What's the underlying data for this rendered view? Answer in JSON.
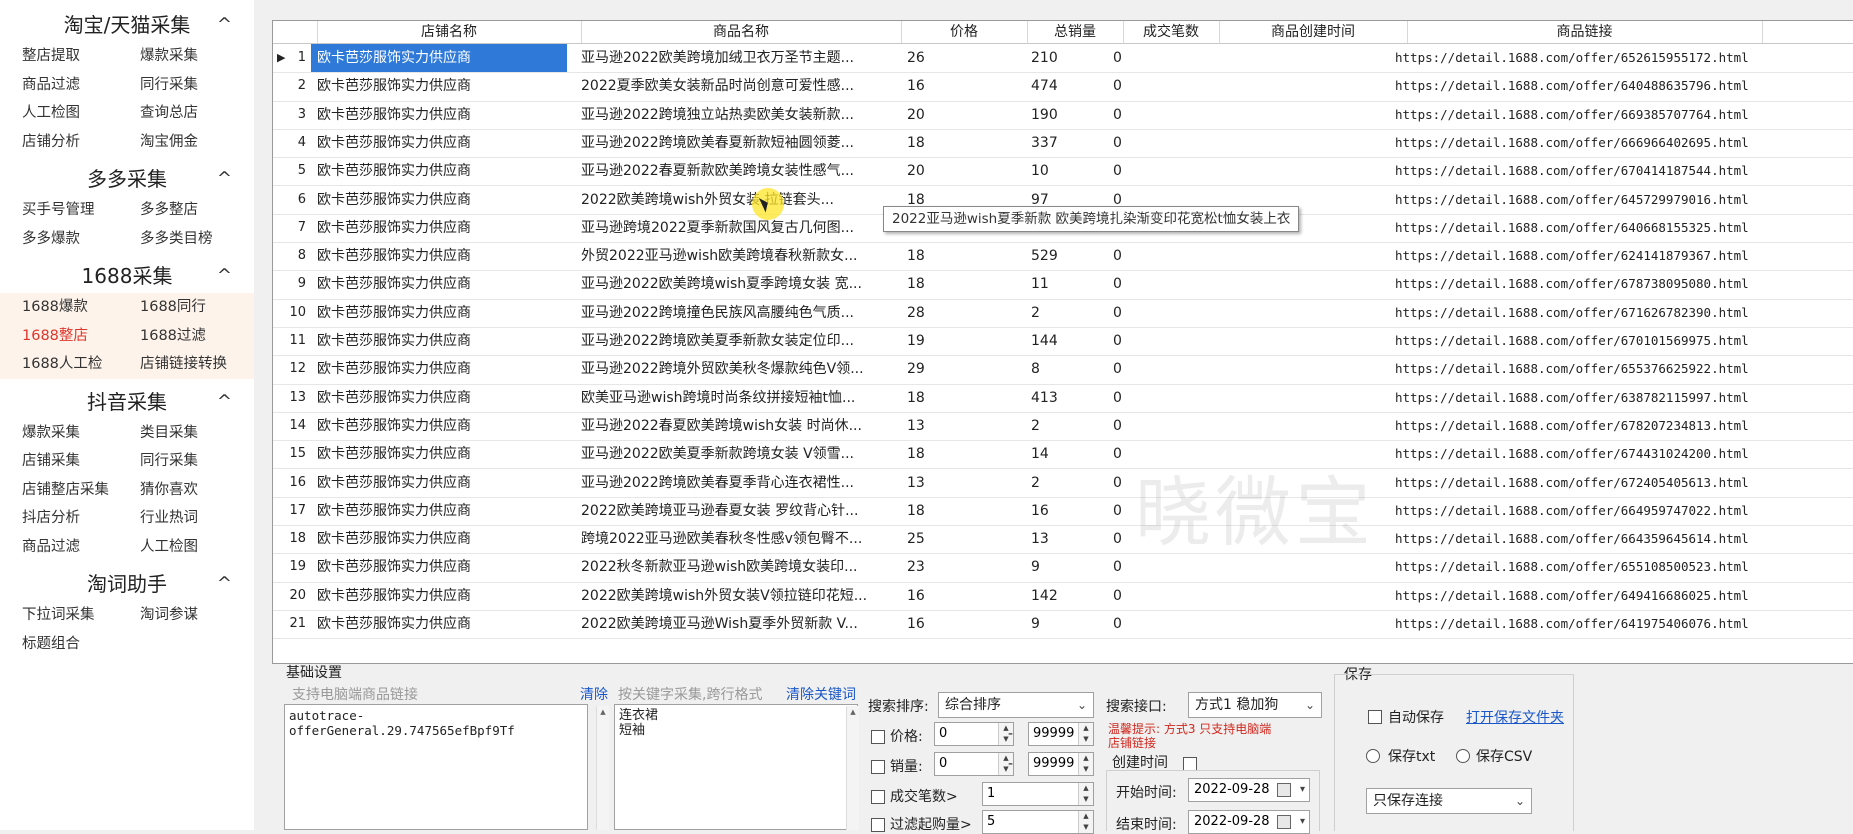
{
  "sidebar": {
    "sections": [
      {
        "title": "淘宝/天猫采集",
        "items": [
          "整店提取",
          "爆款采集",
          "商品过滤",
          "同行采集",
          "人工检图",
          "查询总店",
          "店铺分析",
          "淘宝佣金"
        ]
      },
      {
        "title": "多多采集",
        "items": [
          "买手号管理",
          "多多整店",
          "多多爆款",
          "多多类目榜"
        ]
      },
      {
        "title": "1688采集",
        "items": [
          "1688爆款",
          "1688同行",
          "1688整店",
          "1688过滤",
          "1688人工检",
          "店铺链接转换"
        ]
      },
      {
        "title": "抖音采集",
        "items": [
          "爆款采集",
          "类目采集",
          "店铺采集",
          "同行采集",
          "店铺整店采集",
          "猜你喜欢",
          "抖店分析",
          "行业热词",
          "商品过滤",
          "人工检图"
        ]
      },
      {
        "title": "淘词助手",
        "items": [
          "下拉词采集",
          "淘词参谋",
          "标题组合"
        ]
      }
    ],
    "chevron": "^"
  },
  "table": {
    "headers": [
      "店铺名称",
      "商品名称",
      "价格",
      "总销量",
      "成交笔数",
      "商品创建时间",
      "商品链接"
    ],
    "rows": [
      {
        "idx": "1",
        "shop": "欧卡芭莎服饰实力供应商",
        "name": "亚马逊2022欧美跨境加绒卫衣万圣节主题...",
        "price": "26",
        "sales": "210",
        "deals": "0",
        "link": "https://detail.1688.com/offer/652615955172.html"
      },
      {
        "idx": "2",
        "shop": "欧卡芭莎服饰实力供应商",
        "name": "2022夏季欧美女装新品时尚创意可爱性感...",
        "price": "16",
        "sales": "474",
        "deals": "0",
        "link": "https://detail.1688.com/offer/640488635796.html"
      },
      {
        "idx": "3",
        "shop": "欧卡芭莎服饰实力供应商",
        "name": "亚马逊2022跨境独立站热卖欧美女装新款...",
        "price": "20",
        "sales": "190",
        "deals": "0",
        "link": "https://detail.1688.com/offer/669385707764.html"
      },
      {
        "idx": "4",
        "shop": "欧卡芭莎服饰实力供应商",
        "name": "亚马逊2022跨境欧美春夏新款短袖圆领菱...",
        "price": "18",
        "sales": "337",
        "deals": "0",
        "link": "https://detail.1688.com/offer/666966402695.html"
      },
      {
        "idx": "5",
        "shop": "欧卡芭莎服饰实力供应商",
        "name": "亚马逊2022春夏新款欧美跨境女装性感气...",
        "price": "20",
        "sales": "10",
        "deals": "0",
        "link": "https://detail.1688.com/offer/670414187544.html"
      },
      {
        "idx": "6",
        "shop": "欧卡芭莎服饰实力供应商",
        "name": "2022欧美跨境wish外贸女装 拉链套头...",
        "price": "18",
        "sales": "97",
        "deals": "0",
        "link": "https://detail.1688.com/offer/645729979016.html"
      },
      {
        "idx": "7",
        "shop": "欧卡芭莎服饰实力供应商",
        "name": "亚马逊跨境2022夏季新款国风复古几何图...",
        "price": "18",
        "sales": "148",
        "deals": "0",
        "link": "https://detail.1688.com/offer/640668155325.html"
      },
      {
        "idx": "8",
        "shop": "欧卡芭莎服饰实力供应商",
        "name": "外贸2022亚马逊wish欧美跨境春秋新款女...",
        "price": "18",
        "sales": "529",
        "deals": "0",
        "link": "https://detail.1688.com/offer/624141879367.html"
      },
      {
        "idx": "9",
        "shop": "欧卡芭莎服饰实力供应商",
        "name": "亚马逊2022欧美跨境wish夏季跨境女装 宽...",
        "price": "18",
        "sales": "11",
        "deals": "0",
        "link": "https://detail.1688.com/offer/678738095080.html"
      },
      {
        "idx": "10",
        "shop": "欧卡芭莎服饰实力供应商",
        "name": "亚马逊2022跨境撞色民族风高腰纯色气质...",
        "price": "28",
        "sales": "2",
        "deals": "0",
        "link": "https://detail.1688.com/offer/671626782390.html"
      },
      {
        "idx": "11",
        "shop": "欧卡芭莎服饰实力供应商",
        "name": "亚马逊2022跨境欧美夏季新款女装定位印...",
        "price": "19",
        "sales": "144",
        "deals": "0",
        "link": "https://detail.1688.com/offer/670101569975.html"
      },
      {
        "idx": "12",
        "shop": "欧卡芭莎服饰实力供应商",
        "name": "亚马逊2022跨境外贸欧美秋冬爆款纯色V领...",
        "price": "29",
        "sales": "8",
        "deals": "0",
        "link": "https://detail.1688.com/offer/655376625922.html"
      },
      {
        "idx": "13",
        "shop": "欧卡芭莎服饰实力供应商",
        "name": "欧美亚马逊wish跨境时尚条纹拼接短袖t恤...",
        "price": "18",
        "sales": "413",
        "deals": "0",
        "link": "https://detail.1688.com/offer/638782115997.html"
      },
      {
        "idx": "14",
        "shop": "欧卡芭莎服饰实力供应商",
        "name": "亚马逊2022春夏欧美跨境wish女装 时尚休...",
        "price": "13",
        "sales": "2",
        "deals": "0",
        "link": "https://detail.1688.com/offer/678207234813.html"
      },
      {
        "idx": "15",
        "shop": "欧卡芭莎服饰实力供应商",
        "name": "亚马逊2022欧美夏季新款跨境女装 V领雪...",
        "price": "18",
        "sales": "14",
        "deals": "0",
        "link": "https://detail.1688.com/offer/674431024200.html"
      },
      {
        "idx": "16",
        "shop": "欧卡芭莎服饰实力供应商",
        "name": "亚马逊2022跨境欧美春夏季背心连衣裙性...",
        "price": "13",
        "sales": "2",
        "deals": "0",
        "link": "https://detail.1688.com/offer/672405405613.html"
      },
      {
        "idx": "17",
        "shop": "欧卡芭莎服饰实力供应商",
        "name": "2022欧美跨境亚马逊春夏女装 罗纹背心针...",
        "price": "18",
        "sales": "16",
        "deals": "0",
        "link": "https://detail.1688.com/offer/664959747022.html"
      },
      {
        "idx": "18",
        "shop": "欧卡芭莎服饰实力供应商",
        "name": "跨境2022亚马逊欧美春秋冬性感v领包臀不...",
        "price": "25",
        "sales": "13",
        "deals": "0",
        "link": "https://detail.1688.com/offer/664359645614.html"
      },
      {
        "idx": "19",
        "shop": "欧卡芭莎服饰实力供应商",
        "name": "2022秋冬新款亚马逊wish欧美跨境女装印...",
        "price": "23",
        "sales": "9",
        "deals": "0",
        "link": "https://detail.1688.com/offer/655108500523.html"
      },
      {
        "idx": "20",
        "shop": "欧卡芭莎服饰实力供应商",
        "name": "2022欧美跨境wish外贸女装V领拉链印花短...",
        "price": "16",
        "sales": "142",
        "deals": "0",
        "link": "https://detail.1688.com/offer/649416686025.html"
      },
      {
        "idx": "21",
        "shop": "欧卡芭莎服饰实力供应商",
        "name": "2022欧美跨境亚马逊Wish夏季外贸新款 V...",
        "price": "16",
        "sales": "9",
        "deals": "0",
        "link": "https://detail.1688.com/offer/641975406076.html"
      }
    ],
    "tooltip": "2022亚马逊wish夏季新款 欧美跨境扎染渐变印花宽松t恤女装上衣",
    "watermark": "晓微宝"
  },
  "settings": {
    "title": "基础设置",
    "link_hint": "支持电脑端商品链接",
    "clear": "清除",
    "keyword_hint": "按关键字采集,跨行格式",
    "clear_keywords": "清除关键词",
    "links_value": "autotrace-offerGeneral.29.747565efBpf9Tf",
    "keywords": [
      "连衣裙",
      "短袖"
    ],
    "sort_label": "搜索排序:",
    "sort_value": "综合排序",
    "price_label": "价格:",
    "price_min": "0",
    "price_max": "99999",
    "sales_label": "销量:",
    "sales_min": "0",
    "sales_max": "99999",
    "dash": "-",
    "deals_label": "成交笔数>",
    "deals_value": "1",
    "moq_label": "过滤起购量>",
    "moq_value": "5",
    "api_label": "搜索接口:",
    "api_value": "方式1 稳加狗",
    "warning_line1": "温馨提示: 方式3 只支持电脑端",
    "warning_line2": "店铺链接",
    "created_label": "创建时间",
    "start_label": "开始时间:",
    "start_value": "2022-09-28",
    "end_label": "结束时间:",
    "end_value": "2022-09-28"
  },
  "save": {
    "title": "保存",
    "auto_save": "自动保存",
    "open_folder": "打开保存文件夹",
    "save_txt": "保存txt",
    "save_csv": "保存CSV",
    "mode_value": "只保存连接"
  }
}
